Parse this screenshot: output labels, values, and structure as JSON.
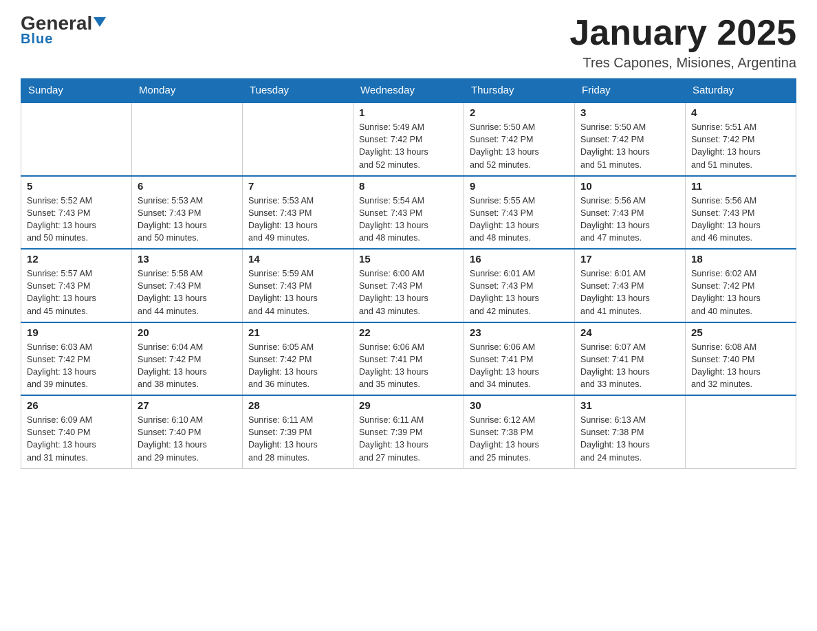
{
  "logo": {
    "general": "General",
    "blue": "Blue"
  },
  "title": "January 2025",
  "subtitle": "Tres Capones, Misiones, Argentina",
  "days_of_week": [
    "Sunday",
    "Monday",
    "Tuesday",
    "Wednesday",
    "Thursday",
    "Friday",
    "Saturday"
  ],
  "weeks": [
    [
      {
        "day": "",
        "info": ""
      },
      {
        "day": "",
        "info": ""
      },
      {
        "day": "",
        "info": ""
      },
      {
        "day": "1",
        "info": "Sunrise: 5:49 AM\nSunset: 7:42 PM\nDaylight: 13 hours\nand 52 minutes."
      },
      {
        "day": "2",
        "info": "Sunrise: 5:50 AM\nSunset: 7:42 PM\nDaylight: 13 hours\nand 52 minutes."
      },
      {
        "day": "3",
        "info": "Sunrise: 5:50 AM\nSunset: 7:42 PM\nDaylight: 13 hours\nand 51 minutes."
      },
      {
        "day": "4",
        "info": "Sunrise: 5:51 AM\nSunset: 7:42 PM\nDaylight: 13 hours\nand 51 minutes."
      }
    ],
    [
      {
        "day": "5",
        "info": "Sunrise: 5:52 AM\nSunset: 7:43 PM\nDaylight: 13 hours\nand 50 minutes."
      },
      {
        "day": "6",
        "info": "Sunrise: 5:53 AM\nSunset: 7:43 PM\nDaylight: 13 hours\nand 50 minutes."
      },
      {
        "day": "7",
        "info": "Sunrise: 5:53 AM\nSunset: 7:43 PM\nDaylight: 13 hours\nand 49 minutes."
      },
      {
        "day": "8",
        "info": "Sunrise: 5:54 AM\nSunset: 7:43 PM\nDaylight: 13 hours\nand 48 minutes."
      },
      {
        "day": "9",
        "info": "Sunrise: 5:55 AM\nSunset: 7:43 PM\nDaylight: 13 hours\nand 48 minutes."
      },
      {
        "day": "10",
        "info": "Sunrise: 5:56 AM\nSunset: 7:43 PM\nDaylight: 13 hours\nand 47 minutes."
      },
      {
        "day": "11",
        "info": "Sunrise: 5:56 AM\nSunset: 7:43 PM\nDaylight: 13 hours\nand 46 minutes."
      }
    ],
    [
      {
        "day": "12",
        "info": "Sunrise: 5:57 AM\nSunset: 7:43 PM\nDaylight: 13 hours\nand 45 minutes."
      },
      {
        "day": "13",
        "info": "Sunrise: 5:58 AM\nSunset: 7:43 PM\nDaylight: 13 hours\nand 44 minutes."
      },
      {
        "day": "14",
        "info": "Sunrise: 5:59 AM\nSunset: 7:43 PM\nDaylight: 13 hours\nand 44 minutes."
      },
      {
        "day": "15",
        "info": "Sunrise: 6:00 AM\nSunset: 7:43 PM\nDaylight: 13 hours\nand 43 minutes."
      },
      {
        "day": "16",
        "info": "Sunrise: 6:01 AM\nSunset: 7:43 PM\nDaylight: 13 hours\nand 42 minutes."
      },
      {
        "day": "17",
        "info": "Sunrise: 6:01 AM\nSunset: 7:43 PM\nDaylight: 13 hours\nand 41 minutes."
      },
      {
        "day": "18",
        "info": "Sunrise: 6:02 AM\nSunset: 7:42 PM\nDaylight: 13 hours\nand 40 minutes."
      }
    ],
    [
      {
        "day": "19",
        "info": "Sunrise: 6:03 AM\nSunset: 7:42 PM\nDaylight: 13 hours\nand 39 minutes."
      },
      {
        "day": "20",
        "info": "Sunrise: 6:04 AM\nSunset: 7:42 PM\nDaylight: 13 hours\nand 38 minutes."
      },
      {
        "day": "21",
        "info": "Sunrise: 6:05 AM\nSunset: 7:42 PM\nDaylight: 13 hours\nand 36 minutes."
      },
      {
        "day": "22",
        "info": "Sunrise: 6:06 AM\nSunset: 7:41 PM\nDaylight: 13 hours\nand 35 minutes."
      },
      {
        "day": "23",
        "info": "Sunrise: 6:06 AM\nSunset: 7:41 PM\nDaylight: 13 hours\nand 34 minutes."
      },
      {
        "day": "24",
        "info": "Sunrise: 6:07 AM\nSunset: 7:41 PM\nDaylight: 13 hours\nand 33 minutes."
      },
      {
        "day": "25",
        "info": "Sunrise: 6:08 AM\nSunset: 7:40 PM\nDaylight: 13 hours\nand 32 minutes."
      }
    ],
    [
      {
        "day": "26",
        "info": "Sunrise: 6:09 AM\nSunset: 7:40 PM\nDaylight: 13 hours\nand 31 minutes."
      },
      {
        "day": "27",
        "info": "Sunrise: 6:10 AM\nSunset: 7:40 PM\nDaylight: 13 hours\nand 29 minutes."
      },
      {
        "day": "28",
        "info": "Sunrise: 6:11 AM\nSunset: 7:39 PM\nDaylight: 13 hours\nand 28 minutes."
      },
      {
        "day": "29",
        "info": "Sunrise: 6:11 AM\nSunset: 7:39 PM\nDaylight: 13 hours\nand 27 minutes."
      },
      {
        "day": "30",
        "info": "Sunrise: 6:12 AM\nSunset: 7:38 PM\nDaylight: 13 hours\nand 25 minutes."
      },
      {
        "day": "31",
        "info": "Sunrise: 6:13 AM\nSunset: 7:38 PM\nDaylight: 13 hours\nand 24 minutes."
      },
      {
        "day": "",
        "info": ""
      }
    ]
  ]
}
